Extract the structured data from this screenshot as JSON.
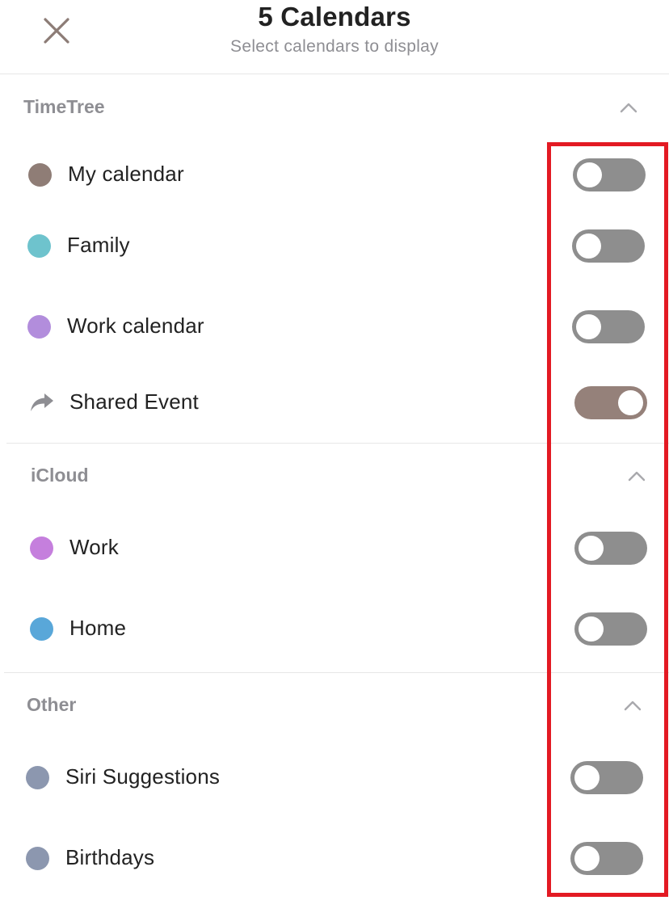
{
  "header": {
    "title": "5 Calendars",
    "subtitle": "Select calendars to display",
    "close_icon": "close-x-icon"
  },
  "sections": [
    {
      "title": "TimeTree",
      "expanded": true,
      "items": [
        {
          "label": "My calendar",
          "color": "#8f7d76",
          "icon": "color-dot",
          "enabled": false
        },
        {
          "label": "Family",
          "color": "#6ec3cd",
          "icon": "color-dot",
          "enabled": false
        },
        {
          "label": "Work calendar",
          "color": "#b28ddc",
          "icon": "color-dot",
          "enabled": false
        },
        {
          "label": "Shared Event",
          "color": "#8e8e93",
          "icon": "share-arrow-icon",
          "enabled": true
        }
      ]
    },
    {
      "title": "iCloud",
      "expanded": true,
      "items": [
        {
          "label": "Work",
          "color": "#c57fdd",
          "icon": "color-dot",
          "enabled": false
        },
        {
          "label": "Home",
          "color": "#59a7d9",
          "icon": "color-dot",
          "enabled": false
        }
      ]
    },
    {
      "title": "Other",
      "expanded": true,
      "items": [
        {
          "label": "Siri Suggestions",
          "color": "#8c97af",
          "icon": "color-dot",
          "enabled": false
        },
        {
          "label": "Birthdays",
          "color": "#8c97af",
          "icon": "color-dot",
          "enabled": false
        }
      ]
    }
  ],
  "colors": {
    "toggle_off": "#8e8e8e",
    "toggle_on": "#95817a",
    "section_title": "#8e8e93",
    "highlight": "#e31a23"
  }
}
